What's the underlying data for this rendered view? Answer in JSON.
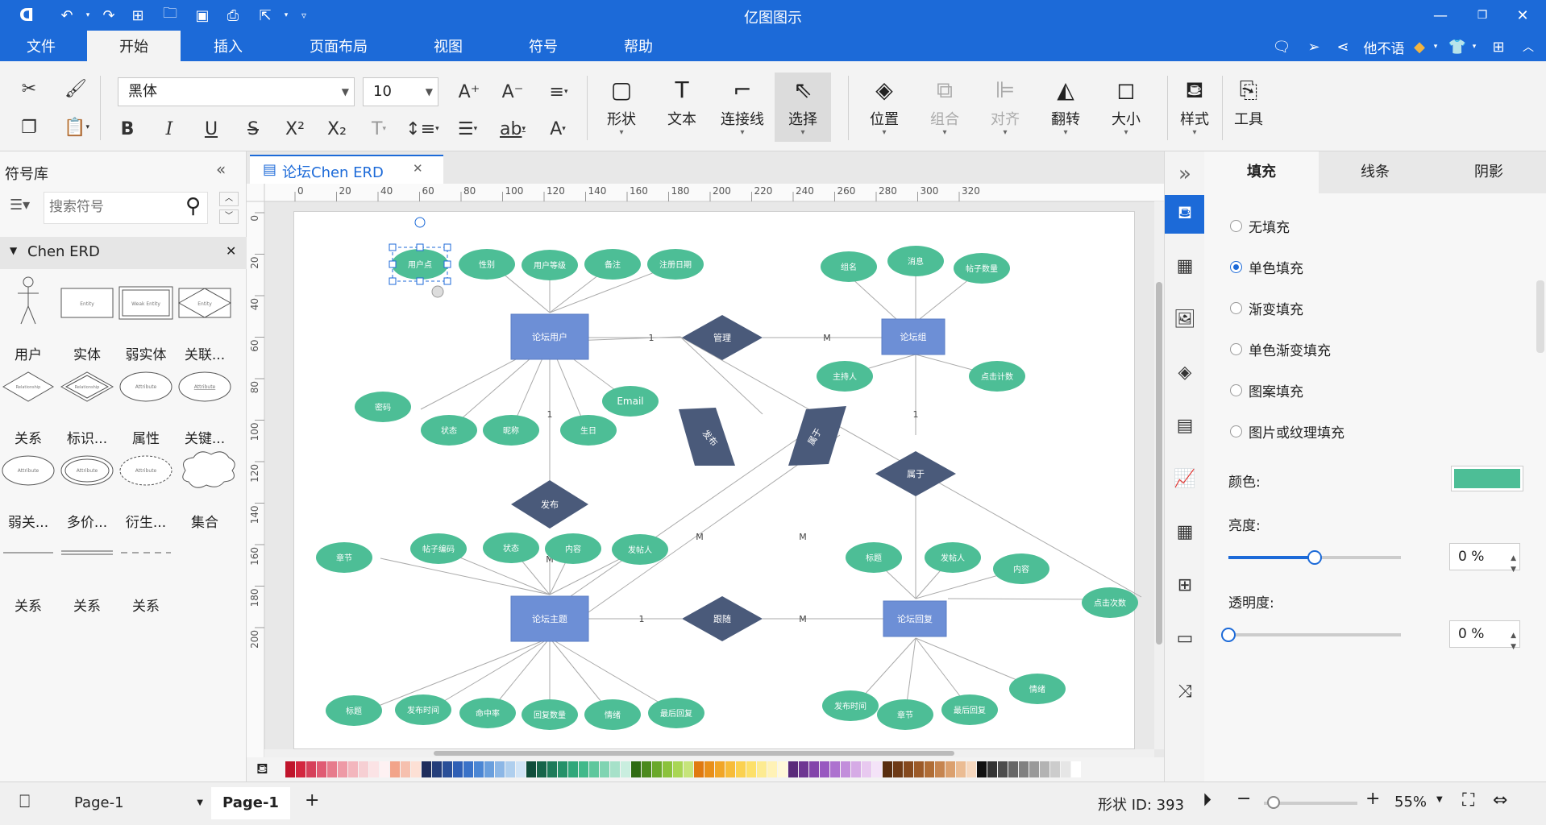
{
  "app": {
    "title": "亿图图示"
  },
  "menu": {
    "items": [
      "文件",
      "开始",
      "插入",
      "页面布局",
      "视图",
      "符号",
      "帮助"
    ],
    "active_index": 1,
    "user": "他不语"
  },
  "ribbon": {
    "font": "黑体",
    "font_size": "10",
    "big_buttons": [
      {
        "label": "形状",
        "icon": "square-icon"
      },
      {
        "label": "文本",
        "icon": "text-t-icon"
      },
      {
        "label": "连接线",
        "icon": "connector-icon"
      },
      {
        "label": "选择",
        "icon": "pointer-icon"
      },
      {
        "label": "位置",
        "icon": "layers-icon"
      },
      {
        "label": "组合",
        "icon": "group-icon"
      },
      {
        "label": "对齐",
        "icon": "align-icon"
      },
      {
        "label": "翻转",
        "icon": "flip-icon"
      },
      {
        "label": "大小",
        "icon": "size-icon"
      },
      {
        "label": "样式",
        "icon": "paint-bucket-icon"
      },
      {
        "label": "工具",
        "icon": "tools-icon"
      }
    ]
  },
  "library": {
    "title": "符号库",
    "search_placeholder": "搜索符号",
    "category": "Chen ERD",
    "shapes": [
      {
        "label": "用户",
        "inner": ""
      },
      {
        "label": "实体",
        "inner": "Entity"
      },
      {
        "label": "弱实体",
        "inner": "Weak Entity"
      },
      {
        "label": "关联...",
        "inner": "Entity"
      },
      {
        "label": "关系",
        "inner": "Relationship"
      },
      {
        "label": "标识...",
        "inner": "Relationship"
      },
      {
        "label": "属性",
        "inner": "Attribute"
      },
      {
        "label": "关键...",
        "inner": "Attribute"
      },
      {
        "label": "弱关...",
        "inner": "Attribute"
      },
      {
        "label": "多价...",
        "inner": "Attribute"
      },
      {
        "label": "衍生...",
        "inner": "Attribute"
      },
      {
        "label": "集合",
        "inner": ""
      },
      {
        "label": "关系",
        "inner": ""
      },
      {
        "label": "关系",
        "inner": ""
      },
      {
        "label": "关系",
        "inner": ""
      }
    ]
  },
  "document": {
    "tab_title": "论坛Chen ERD"
  },
  "ruler": {
    "h": [
      "0",
      "20",
      "40",
      "60",
      "80",
      "100",
      "120",
      "140",
      "160",
      "180",
      "200",
      "220",
      "240",
      "260",
      "280",
      "300",
      "320"
    ],
    "v": [
      "0",
      "20",
      "40",
      "60",
      "80",
      "100",
      "120",
      "140",
      "160",
      "180",
      "200"
    ]
  },
  "diagram": {
    "entities": [
      {
        "id": "user",
        "label": "论坛用户"
      },
      {
        "id": "board",
        "label": "论坛组"
      },
      {
        "id": "topic",
        "label": "论坛主题"
      },
      {
        "id": "reply",
        "label": "论坛回复"
      }
    ],
    "relationships": [
      {
        "label": "管理"
      },
      {
        "label": "发布"
      },
      {
        "label": "属于"
      },
      {
        "label": "跟随"
      },
      {
        "label": "发布"
      },
      {
        "label": "属于"
      }
    ],
    "attributes": [
      "用户点",
      "性别",
      "用户等级",
      "备注",
      "注册日期",
      "密码",
      "状态",
      "昵称",
      "生日",
      "Email",
      "组名",
      "消息",
      "帖子数量",
      "主持人",
      "点击计数",
      "章节",
      "帖子编码",
      "状态",
      "内容",
      "发帖人",
      "标题",
      "发帖人",
      "内容",
      "点击次数",
      "标题",
      "发布时间",
      "命中率",
      "回复数量",
      "情绪",
      "最后回复",
      "发布时间",
      "章节",
      "最后回复",
      "情绪"
    ],
    "cardinality": [
      "1",
      "M",
      "1",
      "1",
      "M",
      "M",
      "M",
      "1",
      "M"
    ]
  },
  "right_panel": {
    "tabs": [
      "填充",
      "线条",
      "阴影"
    ],
    "fill_options": [
      "无填充",
      "单色填充",
      "渐变填充",
      "单色渐变填充",
      "图案填充",
      "图片或纹理填充"
    ],
    "selected_option": 1,
    "color_label": "颜色:",
    "brightness_label": "亮度:",
    "transparency_label": "透明度:",
    "brightness_value": "0 %",
    "transparency_value": "0 %",
    "brightness_level": 0.5,
    "transparency_level": 0,
    "fill_color": "#4dbe96"
  },
  "status": {
    "page_selector": "Page-1",
    "page_tab": "Page-1",
    "shape_id": "形状 ID:  393",
    "zoom": "55%"
  },
  "colors": {
    "accent": "#1c6ad8",
    "entity": "#6d8fd6",
    "relation": "#4a5a7a",
    "attribute": "#4dbe96"
  }
}
